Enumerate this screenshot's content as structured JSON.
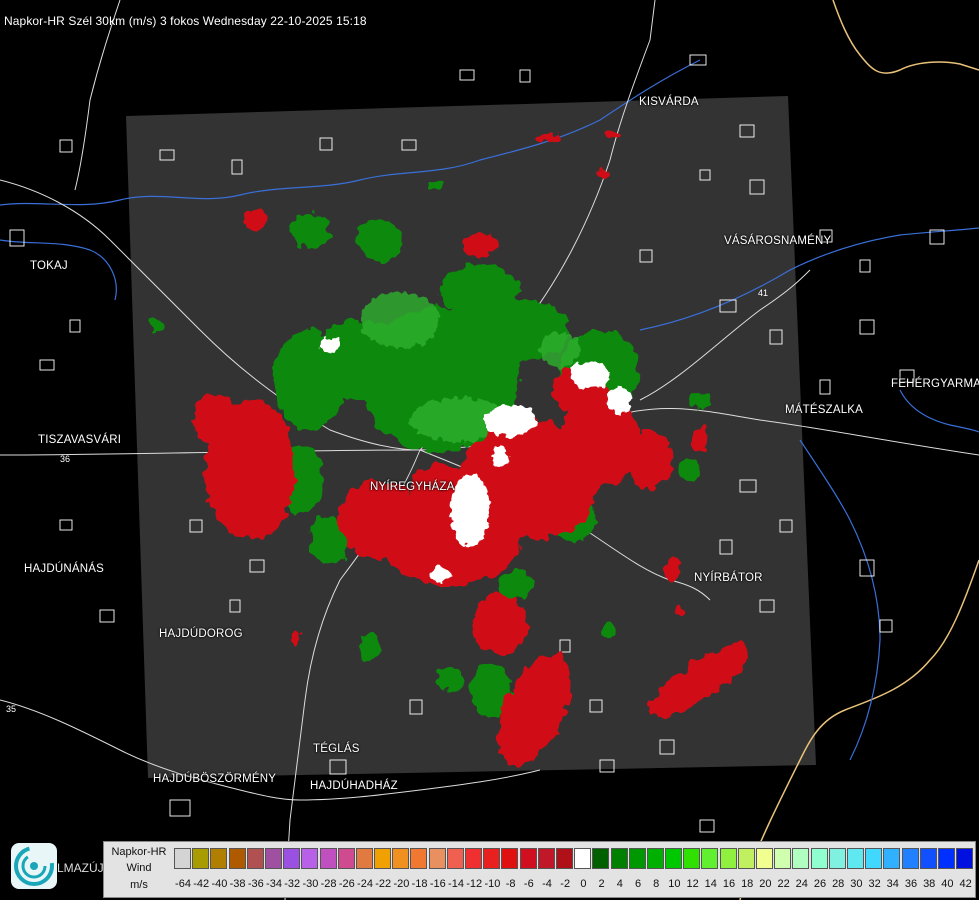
{
  "title": "Napkor-HR Szél 30km (m/s) 3 fokos Wednesday 22-10-2025 15:18",
  "cities": [
    {
      "id": "kisvarda",
      "name": "KISVÁRDA"
    },
    {
      "id": "tokaj",
      "name": "TOKAJ"
    },
    {
      "id": "vasarosnameny",
      "name": "VÁSÁROSNAMÉNY"
    },
    {
      "id": "fehergyarmat",
      "name": "FEHÉRGYARMAT"
    },
    {
      "id": "mateszalka",
      "name": "MÁTÉSZALKA"
    },
    {
      "id": "tiszavasvari",
      "name": "TISZAVASVÁRI"
    },
    {
      "id": "nyiregyhaza",
      "name": "NYÍREGYHÁZA"
    },
    {
      "id": "hajdunanas",
      "name": "HAJDÚNÁNÁS"
    },
    {
      "id": "nyirbator",
      "name": "NYÍRBÁTOR"
    },
    {
      "id": "hajdudorog",
      "name": "HAJDÚDOROG"
    },
    {
      "id": "teglas",
      "name": "TÉGLÁS"
    },
    {
      "id": "hajduboszormeny",
      "name": "HAJDÚBÖSZÖRMÉNY"
    },
    {
      "id": "hajduhadhaz",
      "name": "HAJDÚHADHÁZ"
    }
  ],
  "road_numbers": {
    "r35": "35",
    "r36": "36",
    "r41": "41"
  },
  "legend": {
    "line1": "Napkor-HR",
    "line2": "Wind",
    "unit": "m/s",
    "values": [
      "-64",
      "-42",
      "-40",
      "-38",
      "-36",
      "-34",
      "-32",
      "-30",
      "-28",
      "-26",
      "-24",
      "-22",
      "-20",
      "-18",
      "-16",
      "-14",
      "-12",
      "-10",
      "-8",
      "-6",
      "-4",
      "-2",
      "0",
      "2",
      "4",
      "6",
      "8",
      "10",
      "12",
      "14",
      "16",
      "18",
      "20",
      "22",
      "24",
      "26",
      "28",
      "30",
      "32",
      "34",
      "36",
      "38",
      "40",
      "42"
    ],
    "colors": [
      "#d4d4d4",
      "#a89c00",
      "#b07f00",
      "#b05a00",
      "#b05050",
      "#a050a0",
      "#9a50e0",
      "#b860e8",
      "#c050c0",
      "#d04a90",
      "#e07a40",
      "#f0a000",
      "#f09020",
      "#f07830",
      "#e89060",
      "#f06050",
      "#f03030",
      "#e82020",
      "#e01010",
      "#d01020",
      "#c01828",
      "#b01018",
      "#ffffff",
      "#006000",
      "#008000",
      "#009800",
      "#00b000",
      "#00c800",
      "#30e000",
      "#60f030",
      "#90f040",
      "#c0f060",
      "#f0ff90",
      "#d0ffb0",
      "#b0ffc0",
      "#90ffd0",
      "#80f0e0",
      "#60e8f0",
      "#40d8ff",
      "#30b0ff",
      "#2080ff",
      "#1050ff",
      "#0030ff",
      "#0010e0"
    ]
  },
  "logo_text": "LMAZÚJVÁR"
}
